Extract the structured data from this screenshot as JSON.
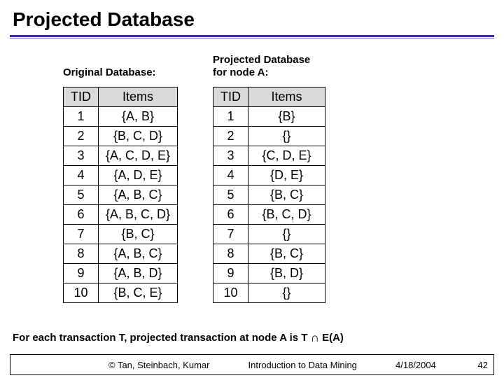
{
  "title": "Projected Database",
  "left": {
    "heading": "Original Database:",
    "headers": {
      "tid": "TID",
      "items": "Items"
    },
    "rows": [
      {
        "tid": "1",
        "items": "{A, B}"
      },
      {
        "tid": "2",
        "items": "{B, C, D}"
      },
      {
        "tid": "3",
        "items": "{A, C, D, E}"
      },
      {
        "tid": "4",
        "items": "{A, D, E}"
      },
      {
        "tid": "5",
        "items": "{A, B, C}"
      },
      {
        "tid": "6",
        "items": "{A, B, C, D}"
      },
      {
        "tid": "7",
        "items": "{B, C}"
      },
      {
        "tid": "8",
        "items": "{A, B, C}"
      },
      {
        "tid": "9",
        "items": "{A, B, D}"
      },
      {
        "tid": "10",
        "items": "{B, C, E}"
      }
    ]
  },
  "right": {
    "heading": "Projected Database\nfor node A:",
    "headers": {
      "tid": "TID",
      "items": "Items"
    },
    "rows": [
      {
        "tid": "1",
        "items": "{B}"
      },
      {
        "tid": "2",
        "items": "{}"
      },
      {
        "tid": "3",
        "items": "{C, D, E}"
      },
      {
        "tid": "4",
        "items": "{D, E}"
      },
      {
        "tid": "5",
        "items": "{B, C}"
      },
      {
        "tid": "6",
        "items": "{B, C, D}"
      },
      {
        "tid": "7",
        "items": "{}"
      },
      {
        "tid": "8",
        "items": "{B, C}"
      },
      {
        "tid": "9",
        "items": "{B, D}"
      },
      {
        "tid": "10",
        "items": "{}"
      }
    ]
  },
  "footnote": {
    "pre": "For each transaction T, projected transaction at node A is T ",
    "op": "∩",
    "post": " E(A)"
  },
  "footer": {
    "copyright": "© Tan, Steinbach, Kumar",
    "center": "Introduction to Data Mining",
    "date": "4/18/2004",
    "page": "42"
  }
}
